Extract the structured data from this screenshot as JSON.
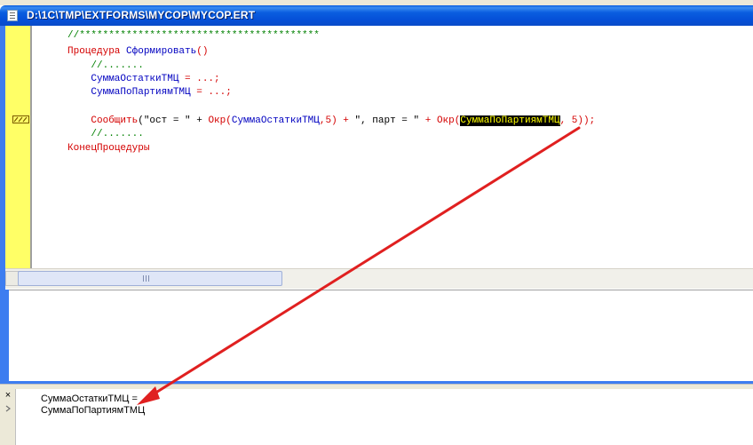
{
  "window": {
    "title": "D:\\1C\\TMP\\EXTFORMS\\MYCOP\\MYCOP.ERT"
  },
  "code_lines": [
    {
      "parts": [
        {
          "t": "//*****************************************",
          "c": "comment"
        }
      ]
    },
    {
      "parts": [
        {
          "t": "Процедура ",
          "c": "kw"
        },
        {
          "t": "Сформировать",
          "c": "id"
        },
        {
          "t": "()",
          "c": "op"
        }
      ]
    },
    {
      "parts": [
        {
          "t": "    //.......",
          "c": "comment"
        }
      ]
    },
    {
      "parts": [
        {
          "t": "    СуммаОстаткиТМЦ",
          "c": "id"
        },
        {
          "t": " = ...;",
          "c": "op"
        }
      ]
    },
    {
      "parts": [
        {
          "t": "    СуммаПоПартиямТМЦ",
          "c": "id"
        },
        {
          "t": " = ...;",
          "c": "op"
        }
      ]
    },
    {
      "parts": [
        {
          "t": "",
          "c": "txt"
        }
      ]
    },
    {
      "parts": [
        {
          "t": "    Сообщить",
          "c": "kw"
        },
        {
          "t": "(\"ост = \" + ",
          "c": "txt"
        },
        {
          "t": "Окр",
          "c": "kw"
        },
        {
          "t": "(",
          "c": "op"
        },
        {
          "t": "СуммаОстаткиТМЦ",
          "c": "id"
        },
        {
          "t": ",5) + ",
          "c": "op"
        },
        {
          "t": "\", парт = \"",
          "c": "txt"
        },
        {
          "t": " + ",
          "c": "op"
        },
        {
          "t": "Окр",
          "c": "kw"
        },
        {
          "t": "(",
          "c": "op"
        },
        {
          "t": "СуммаПоПартиямТМЦ",
          "c": "hl"
        },
        {
          "t": ", 5));",
          "c": "op"
        }
      ]
    },
    {
      "parts": [
        {
          "t": "    //.......",
          "c": "comment"
        }
      ]
    },
    {
      "parts": [
        {
          "t": "КонецПроцедуры",
          "c": "kw"
        }
      ]
    }
  ],
  "output": {
    "lines": [
      "СуммаОстаткиТМЦ = ",
      "СуммаПоПартиямТМЦ"
    ]
  },
  "icons": {
    "title": "document-icon",
    "breakpoint": "breakpoint-marker-icon",
    "close": "close-icon"
  },
  "colors": {
    "titlebar": "#0a5ee0",
    "gutter": "#ffff66",
    "keyword": "#d40000",
    "identifier": "#0000c0",
    "comment": "#008000",
    "highlight_bg": "#000000",
    "highlight_fg": "#ffff00",
    "arrow": "#e02020"
  }
}
